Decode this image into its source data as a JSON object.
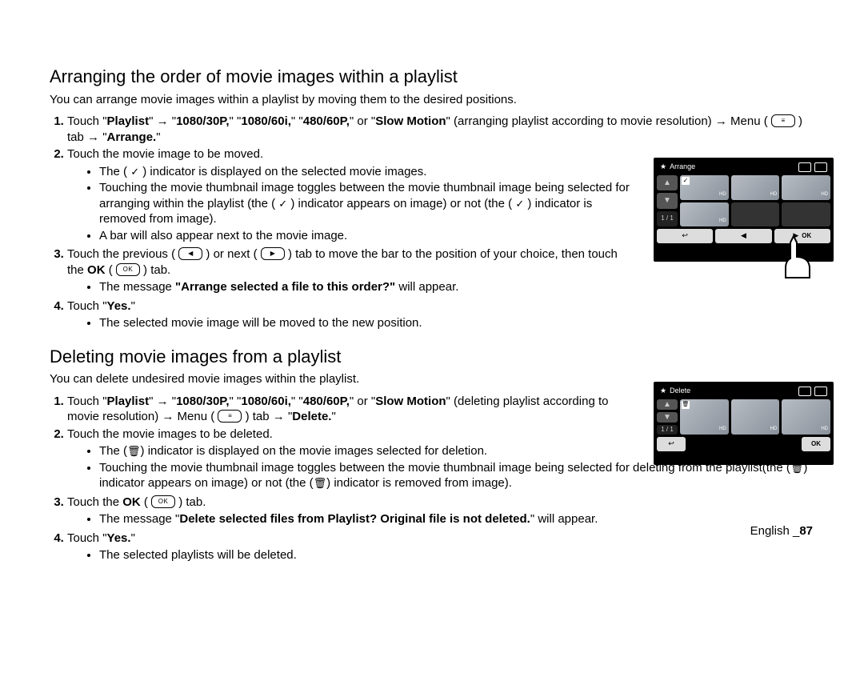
{
  "section1": {
    "heading": "Arranging the order of movie images within a playlist",
    "intro": "You can arrange movie images within a playlist by moving them to the desired positions.",
    "step1_a": "Touch \"",
    "playlist": "Playlist",
    "step1_b": "\" ",
    "arrow": "→",
    "step1_c": " \"",
    "r1": "1080/30P,",
    "step1_d": "\" \"",
    "r2": "1080/60i,",
    "step1_e": "\" \"",
    "r3": "480/60P,",
    "step1_f": "\" or \"",
    "r4": "Slow Motion",
    "step1_g": "\" (arranging playlist according to movie resolution) ",
    "step1_h": " Menu ( ",
    "step1_i": " ) tab ",
    "step1_j": " \"",
    "arrange": "Arrange.",
    "step1_k": "\"",
    "step2": "Touch the movie image to be moved.",
    "s2b1a": "The ( ",
    "s2b1b": " ) indicator is displayed on the selected movie images.",
    "s2b2a": "Touching the movie thumbnail image toggles between the movie thumbnail image being selected for arranging within the playlist (the ( ",
    "s2b2b": " ) indicator appears on image) or not (the ( ",
    "s2b2c": " ) indicator is removed from image).",
    "s2b3": "A bar will also appear next to the movie image.",
    "step3a": "Touch the previous ( ",
    "step3b": " ) or next ( ",
    "step3c": " ) tab to move the bar to the position of your choice, then touch the ",
    "okword": "OK",
    "step3d": " ( ",
    "step3e": " ) tab.",
    "s3b1a": "The message ",
    "s3b1msg": "\"Arrange selected a file to this order?\"",
    "s3b1b": " will appear.",
    "step4a": "Touch \"",
    "yes": "Yes.",
    "step4b": "\"",
    "s4b1": "The selected movie image will be moved to the new position."
  },
  "section2": {
    "heading": "Deleting movie images from a playlist",
    "intro": "You can delete undesired movie images within the playlist.",
    "step1_a": "Touch \"",
    "playlist": "Playlist",
    "step1_b": "\" ",
    "arrow": "→",
    "step1_c": " \"",
    "r1": "1080/30P,",
    "step1_d": "\" \"",
    "r2": "1080/60i,",
    "step1_e": "\" \"",
    "r3": "480/60P,",
    "step1_f": "\" or \"",
    "r4": "Slow Motion",
    "step1_g": "\" (deleting playlist according to movie resolution) ",
    "step1_h": " Menu ( ",
    "step1_i": " ) tab ",
    "step1_j": " \"",
    "delete": "Delete.",
    "step1_k": "\"",
    "step2": "Touch the movie images to be deleted.",
    "s2b1a": "The (",
    "s2b1b": ") indicator is displayed on the movie images selected for deletion.",
    "s2b2a": "Touching the movie thumbnail image toggles between the movie thumbnail image being selected for deleting from the playlist(the (",
    "s2b2b": ") indicator appears on image) or not (the (",
    "s2b2c": ") indicator is removed from image).",
    "step3a": "Touch the ",
    "okword": "OK",
    "step3b": " ( ",
    "step3c": " ) tab.",
    "s3b1a": "The message \"",
    "s3b1msg": "Delete selected files from Playlist? Original file is not deleted.",
    "s3b1b": "\" will appear.",
    "step4a": "Touch \"",
    "yes": "Yes.",
    "step4b": "\"",
    "s4b1": "The selected playlists will be deleted."
  },
  "device1": {
    "title": "Arrange",
    "page": "1 / 1",
    "ok": "OK",
    "hd": "HD"
  },
  "device2": {
    "title": "Delete",
    "page": "1 / 1",
    "ok": "OK",
    "hd": "HD"
  },
  "footer": {
    "lang": "English _",
    "page": "87"
  },
  "glyphs": {
    "menu": "≡",
    "check": "✓",
    "prev": "◀",
    "next": "▶",
    "ok": "OK",
    "trash": "🗑",
    "return": "↩",
    "up": "▲",
    "down": "▼",
    "star": "★"
  }
}
